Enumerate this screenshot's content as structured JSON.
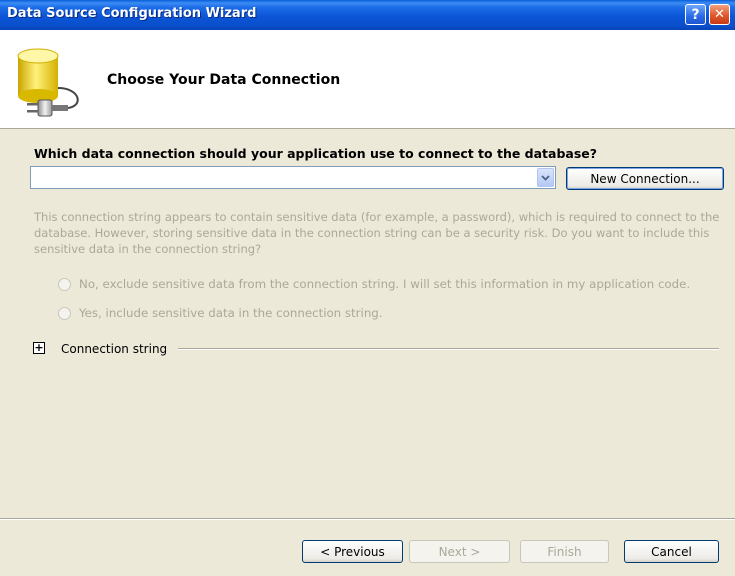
{
  "window": {
    "title": "Data Source Configuration Wizard",
    "help_glyph": "?",
    "close_glyph": "✕"
  },
  "header": {
    "title": "Choose Your Data Connection",
    "icon": "database-connection-icon"
  },
  "connection": {
    "question": "Which data connection should your application use to connect to the database?",
    "selected_value": "",
    "new_connection_label": "New Connection..."
  },
  "sensitive": {
    "description": "This connection string appears to contain sensitive data (for example, a password), which is required to connect to the database. However, storing sensitive data in the connection string can be a security risk. Do you want to include this sensitive data in the connection string?",
    "option_no": "No, exclude sensitive data from the connection string. I will set this information in my application code.",
    "option_yes": "Yes, include sensitive data in the connection string."
  },
  "connection_string": {
    "expander_glyph": "+",
    "label": "Connection string"
  },
  "footer": {
    "previous_label": "< Previous",
    "next_label": "Next >",
    "finish_label": "Finish",
    "cancel_label": "Cancel"
  },
  "colors": {
    "titlebar": "#0a55d6",
    "dialog_background": "#ece9d8",
    "disabled_text": "#aca899"
  }
}
